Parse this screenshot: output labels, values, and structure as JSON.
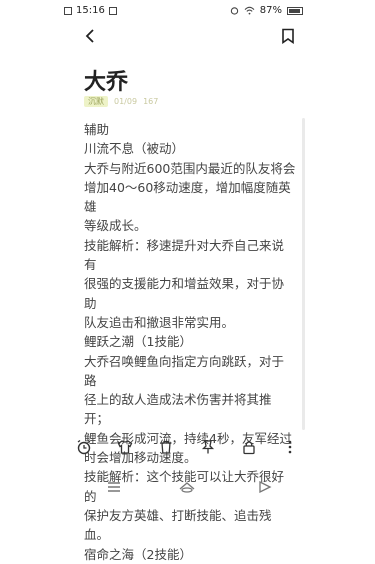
{
  "status_bar": {
    "time": "15:16",
    "battery": "87%"
  },
  "note": {
    "title": "大乔",
    "meta_tag": "沉默",
    "meta_date": "01/09",
    "meta_extra": "167",
    "lines": [
      "辅助",
      "川流不息（被动）",
      "大乔与附近600范围内最近的队友将会",
      "增加40～60移动速度，增加幅度随英雄",
      "等级成长。",
      "技能解析：移速提升对大乔自己来说有",
      "很强的支援能力和增益效果，对于协助",
      "队友追击和撤退非常实用。",
      "鲤跃之潮（1技能）",
      "大乔召唤鲤鱼向指定方向跳跃，对于路",
      "径上的敌人造成法术伤害并将其推开；",
      "鲤鱼会形成河流，持续4秒，友军经过",
      "时会增加移动速度。",
      "技能解析：这个技能可以让大乔很好的",
      "保护友方英雄、打断技能、追击残血。",
      "宿命之海（2技能）"
    ]
  },
  "icons": {
    "back": "back-arrow-icon",
    "bookmark": "bookmark-icon",
    "alarm": "alarm-clock-icon",
    "shirt": "theme-shirt-icon",
    "delete": "trash-icon",
    "pin": "pin-icon",
    "lock": "lock-icon",
    "more": "more-vertical-icon",
    "nav_menu": "menu-icon",
    "nav_home": "home-icon",
    "nav_back": "back-icon"
  }
}
